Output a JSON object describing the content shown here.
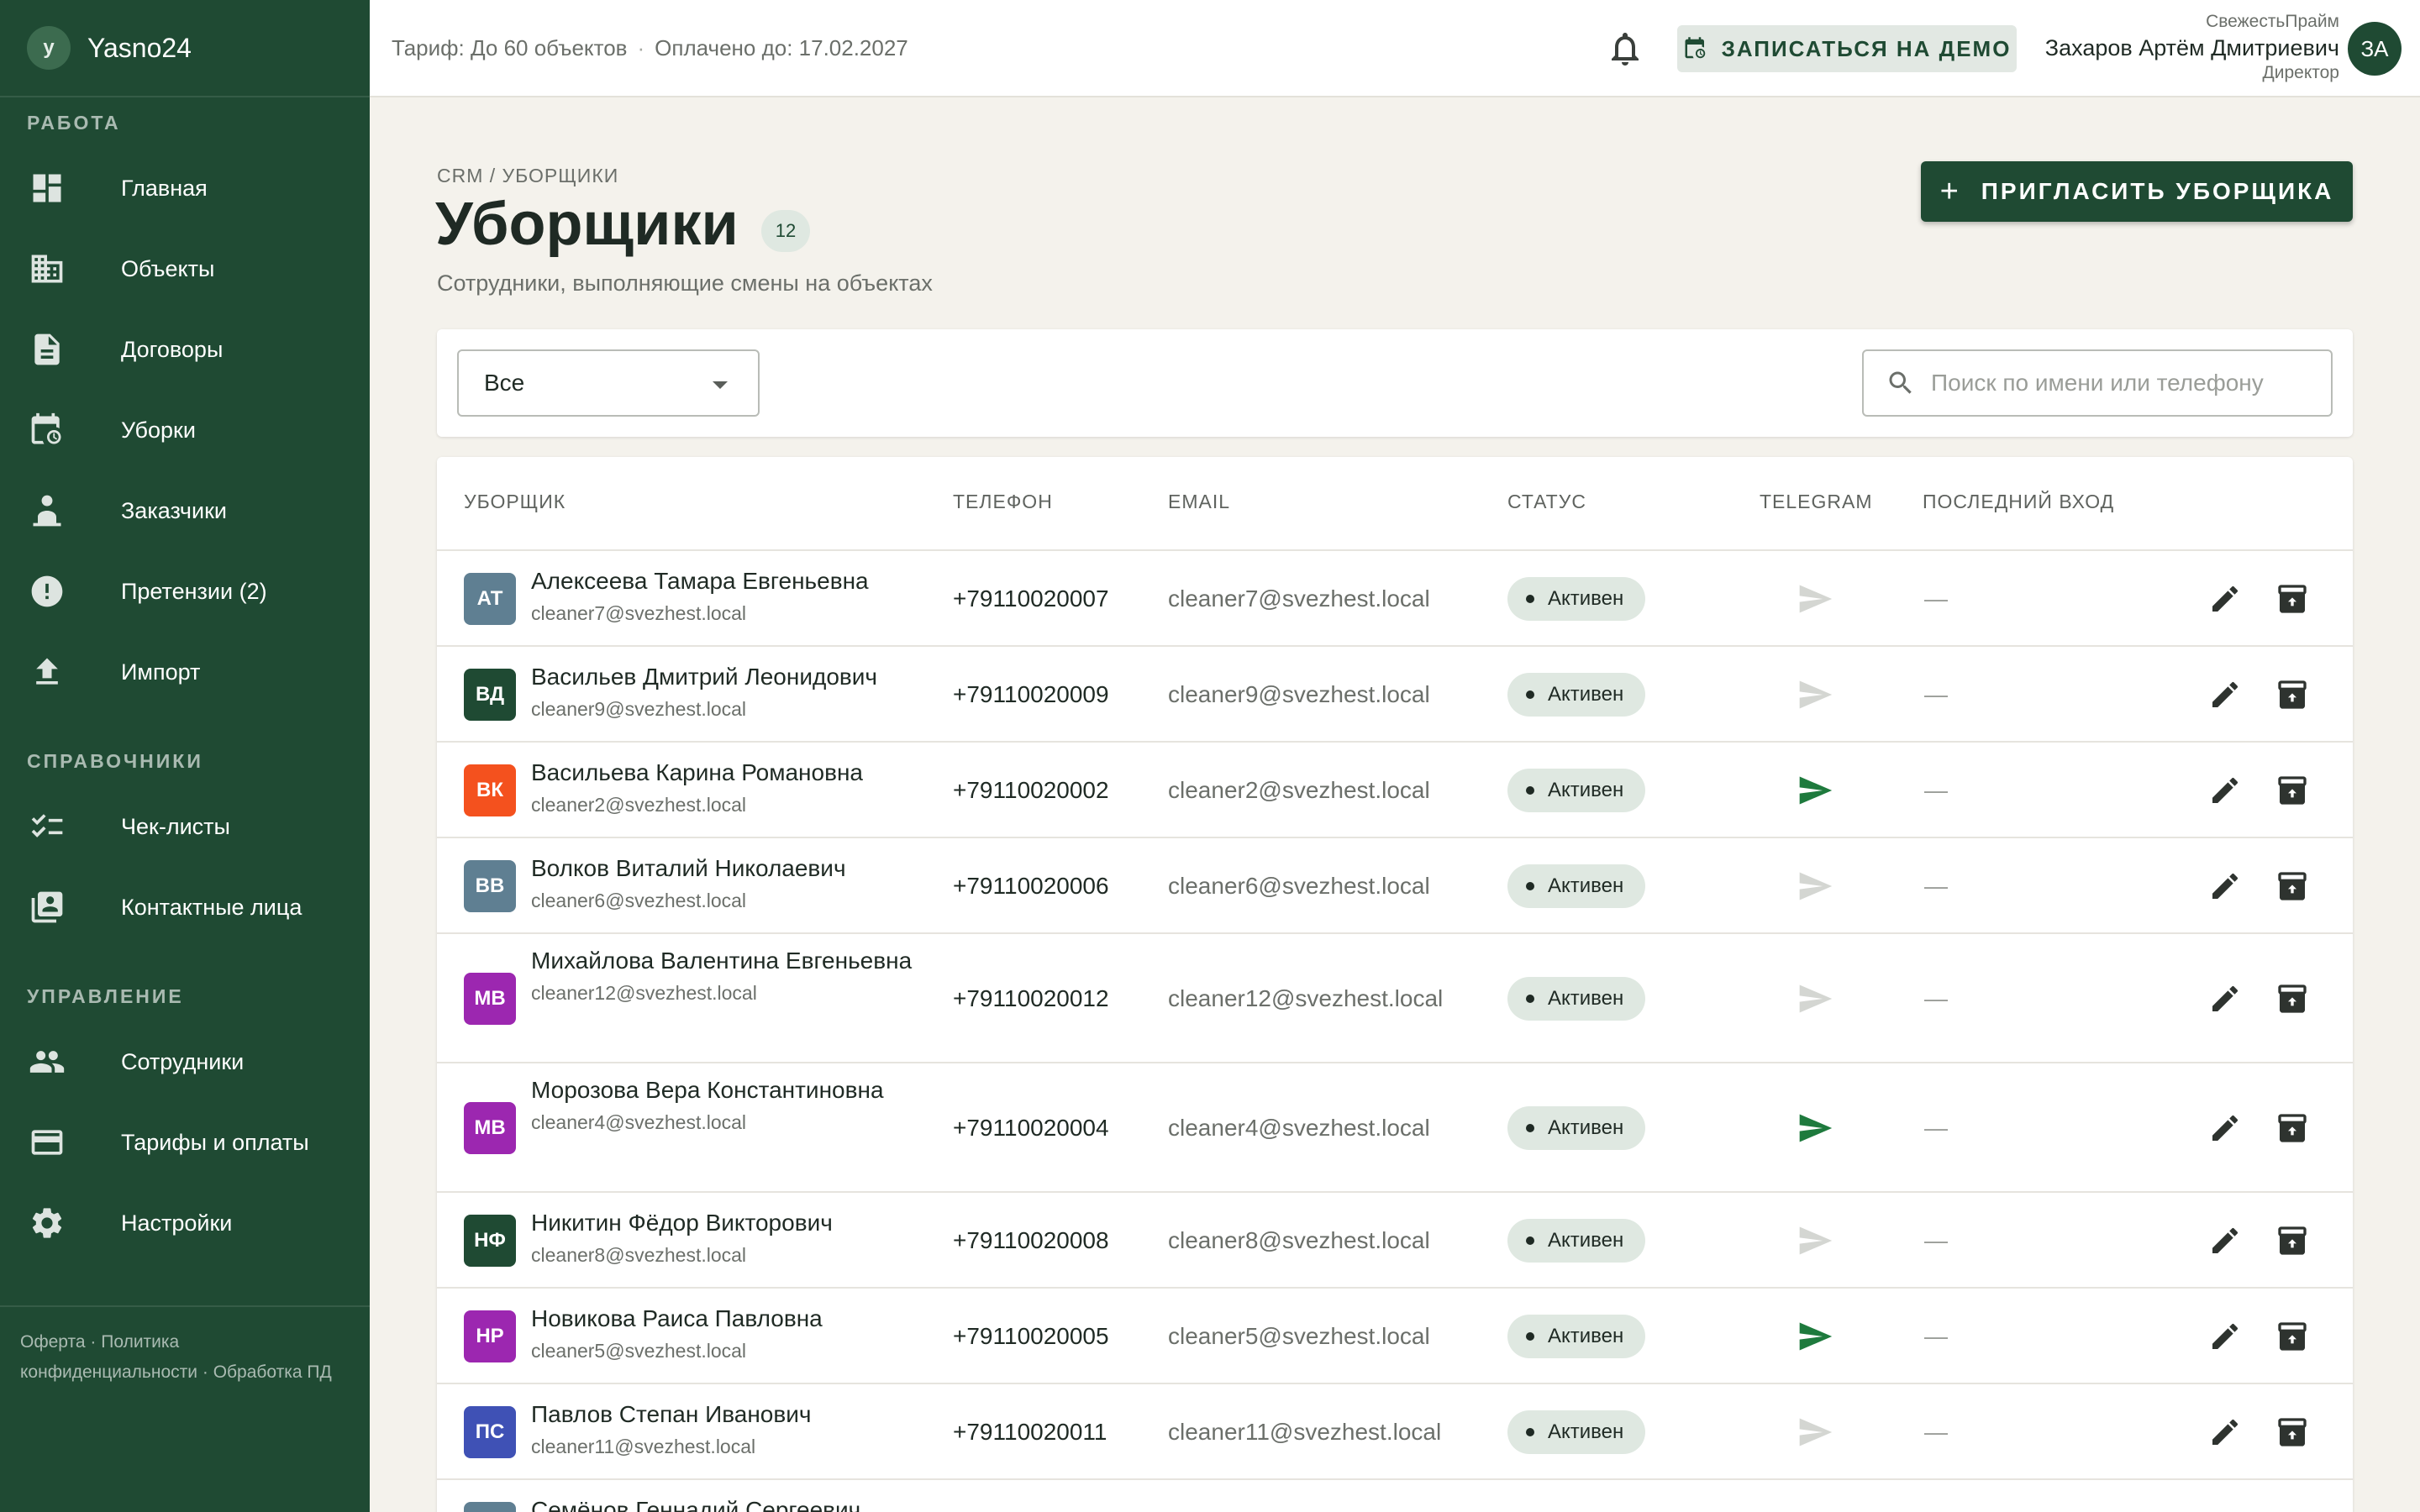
{
  "brand": {
    "logo_letter": "y",
    "name": "Yasno24"
  },
  "sidebar": {
    "sections": [
      {
        "title": "РАБОТА"
      },
      {
        "title": "СПРАВОЧНИКИ"
      },
      {
        "title": "УПРАВЛЕНИЕ"
      }
    ],
    "work_items": [
      {
        "label": "Главная",
        "icon": "dashboard-icon"
      },
      {
        "label": "Объекты",
        "icon": "building-icon"
      },
      {
        "label": "Договоры",
        "icon": "document-icon"
      },
      {
        "label": "Уборки",
        "icon": "calendar-clock-icon"
      },
      {
        "label": "Заказчики",
        "icon": "customer-icon"
      },
      {
        "label": "Претензии (2)",
        "icon": "alert-circle-icon"
      },
      {
        "label": "Импорт",
        "icon": "upload-icon"
      }
    ],
    "ref_items": [
      {
        "label": "Чек-листы",
        "icon": "checklist-icon"
      },
      {
        "label": "Контактные лица",
        "icon": "contacts-icon"
      }
    ],
    "mgmt_items": [
      {
        "label": "Сотрудники",
        "icon": "people-icon"
      },
      {
        "label": "Тарифы и оплаты",
        "icon": "credit-card-icon"
      },
      {
        "label": "Настройки",
        "icon": "gear-icon"
      }
    ],
    "footer": {
      "offer": "Оферта",
      "policy": "Политика конфиденциальности",
      "pd": "Обработка ПД",
      "sep": "·"
    }
  },
  "topbar": {
    "tariff": "Тариф: До 60 объектов",
    "dot": "·",
    "paid_until": "Оплачено до: 17.02.2027",
    "demo_label": "ЗАПИСАТЬСЯ НА ДЕМО",
    "user": {
      "org": "СвежестьПрайм",
      "name": "Захаров Артём Дмитриевич",
      "role": "Директор",
      "initials": "ЗА"
    }
  },
  "page": {
    "breadcrumb": "CRM / УБОРЩИКИ",
    "title": "Уборщики",
    "count": "12",
    "subtitle": "Сотрудники, выполняющие смены на объектах",
    "invite_label": "ПРИГЛАСИТЬ УБОРЩИКА",
    "invite_plus": "+"
  },
  "filters": {
    "status_value": "Все",
    "search_placeholder": "Поиск по имени или телефону"
  },
  "table": {
    "headers": {
      "cleaner": "УБОРЩИК",
      "phone": "ТЕЛЕФОН",
      "email": "EMAIL",
      "status": "СТАТУС",
      "telegram": "TELEGRAM",
      "last_login": "ПОСЛЕДНИЙ ВХОД"
    },
    "colors": {
      "telegram_active": "#1e7a3d",
      "telegram_inactive": "#d4d6d2"
    },
    "rows": [
      {
        "initials": "АТ",
        "color": "#5f7f92",
        "name": "Алексеева Тамара Евгеньевна",
        "phone": "+79110020007",
        "email": "cleaner7@svezhest.local",
        "status": "Активен",
        "telegram": false,
        "last": "—"
      },
      {
        "initials": "ВД",
        "color": "#1f4a33",
        "name": "Васильев Дмитрий Леонидович",
        "phone": "+79110020009",
        "email": "cleaner9@svezhest.local",
        "status": "Активен",
        "telegram": false,
        "last": "—"
      },
      {
        "initials": "ВК",
        "color": "#f4511e",
        "name": "Васильева Карина Романовна",
        "phone": "+79110020002",
        "email": "cleaner2@svezhest.local",
        "status": "Активен",
        "telegram": true,
        "last": "—"
      },
      {
        "initials": "ВВ",
        "color": "#5f7f92",
        "name": "Волков Виталий Николаевич",
        "phone": "+79110020006",
        "email": "cleaner6@svezhest.local",
        "status": "Активен",
        "telegram": false,
        "last": "—"
      },
      {
        "initials": "МВ",
        "color": "#9c27b0",
        "name": "Михайлова Валентина Евгеньевна",
        "phone": "+79110020012",
        "email": "cleaner12@svezhest.local",
        "status": "Активен",
        "telegram": false,
        "last": "—"
      },
      {
        "initials": "МВ",
        "color": "#9c27b0",
        "name": "Морозова Вера Константиновна",
        "phone": "+79110020004",
        "email": "cleaner4@svezhest.local",
        "status": "Активен",
        "telegram": true,
        "last": "—"
      },
      {
        "initials": "НФ",
        "color": "#1f4a33",
        "name": "Никитин Фёдор Викторович",
        "phone": "+79110020008",
        "email": "cleaner8@svezhest.local",
        "status": "Активен",
        "telegram": false,
        "last": "—"
      },
      {
        "initials": "НР",
        "color": "#9c27b0",
        "name": "Новикова Раиса Павловна",
        "phone": "+79110020005",
        "email": "cleaner5@svezhest.local",
        "status": "Активен",
        "telegram": true,
        "last": "—"
      },
      {
        "initials": "ПС",
        "color": "#3f51b5",
        "name": "Павлов Степан Иванович",
        "phone": "+79110020011",
        "email": "cleaner11@svezhest.local",
        "status": "Активен",
        "telegram": false,
        "last": "—"
      },
      {
        "initials": "СГ",
        "color": "#5f7f92",
        "name": "Семёнов Геннадий Сергеевич",
        "phone": "",
        "email": "",
        "status": "",
        "telegram": false,
        "last": ""
      }
    ]
  }
}
